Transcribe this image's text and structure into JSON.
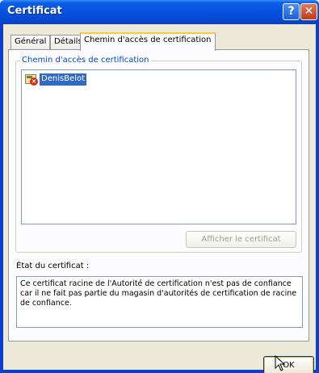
{
  "window": {
    "title": "Certificat"
  },
  "titlebar": {
    "help_label": "?",
    "close_label": "✕"
  },
  "tabs": [
    {
      "label": "Général"
    },
    {
      "label": "Détails"
    },
    {
      "label": "Chemin d'accès de certification",
      "active": true
    }
  ],
  "path_group": {
    "legend": "Chemin d'accès de certification",
    "items": [
      {
        "label": "DenisBelot",
        "selected": true,
        "icon": "certificate-error-icon"
      }
    ],
    "view_button_label": "Afficher le certificat",
    "view_button_enabled": false
  },
  "status": {
    "label": "État du certificat :",
    "text": "Ce certificat racine de l'Autorité de certification n'est pas de confiance car il ne fait pas partie du magasin d'autorités de certification de racine de confiance."
  },
  "ok_button_label": "OK",
  "colors": {
    "title_bar": "#0553e0",
    "selection": "#316ac5",
    "legend_text": "#0046d5",
    "active_tab_accent": "#ffc83c"
  }
}
